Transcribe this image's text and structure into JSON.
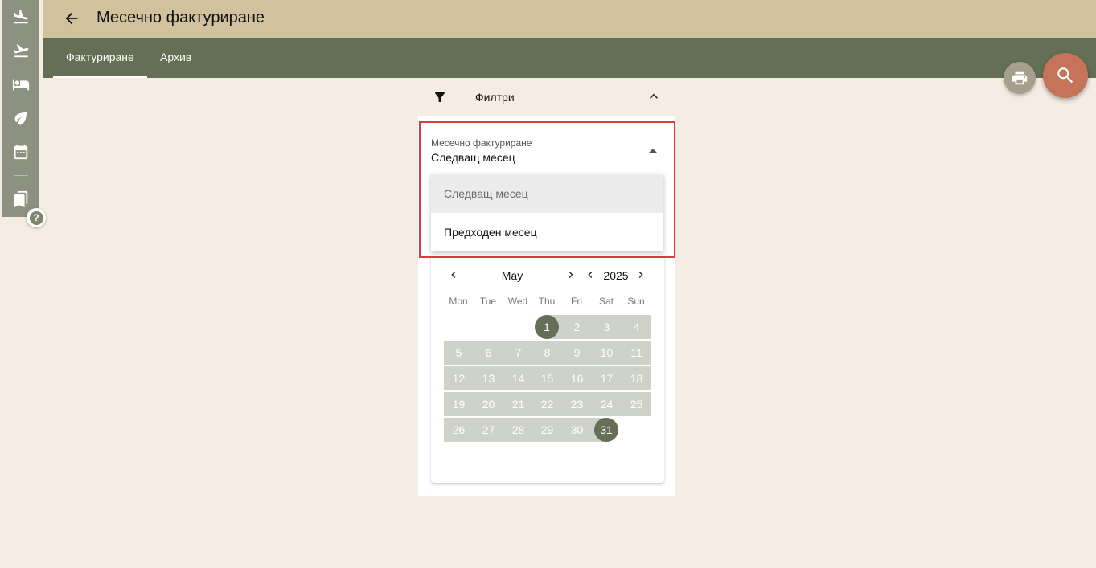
{
  "header": {
    "title": "Месечно фактуриране"
  },
  "tabs": [
    {
      "label": "Фактуриране",
      "active": true
    },
    {
      "label": "Архив",
      "active": false
    }
  ],
  "rail": {
    "icons": [
      "flight-land-icon",
      "flight-takeoff-icon",
      "hotel-icon",
      "eco-leaf-icon",
      "calendar-icon",
      "bookmarks-icon"
    ],
    "help_label": "?"
  },
  "filters": {
    "label": "Филтри",
    "field_label": "Месечно фактуриране",
    "field_value": "Следващ месец",
    "options": [
      "Следващ месец",
      "Предходен месец"
    ],
    "selected_index": 0
  },
  "calendar": {
    "month": "May",
    "year": "2025",
    "weekdays": [
      "Mon",
      "Tue",
      "Wed",
      "Thu",
      "Fri",
      "Sat",
      "Sun"
    ],
    "first_weekday_index": 3,
    "days_in_month": 31,
    "range_start": 1,
    "range_end": 31
  },
  "colors": {
    "topbar": "#d2c19d",
    "tabbar": "#646f55",
    "background": "#f5ece3",
    "accent_search": "#c7735a",
    "range_fill": "#cfd2c9",
    "range_endpoint": "#646f55",
    "highlight": "#e0393e"
  }
}
